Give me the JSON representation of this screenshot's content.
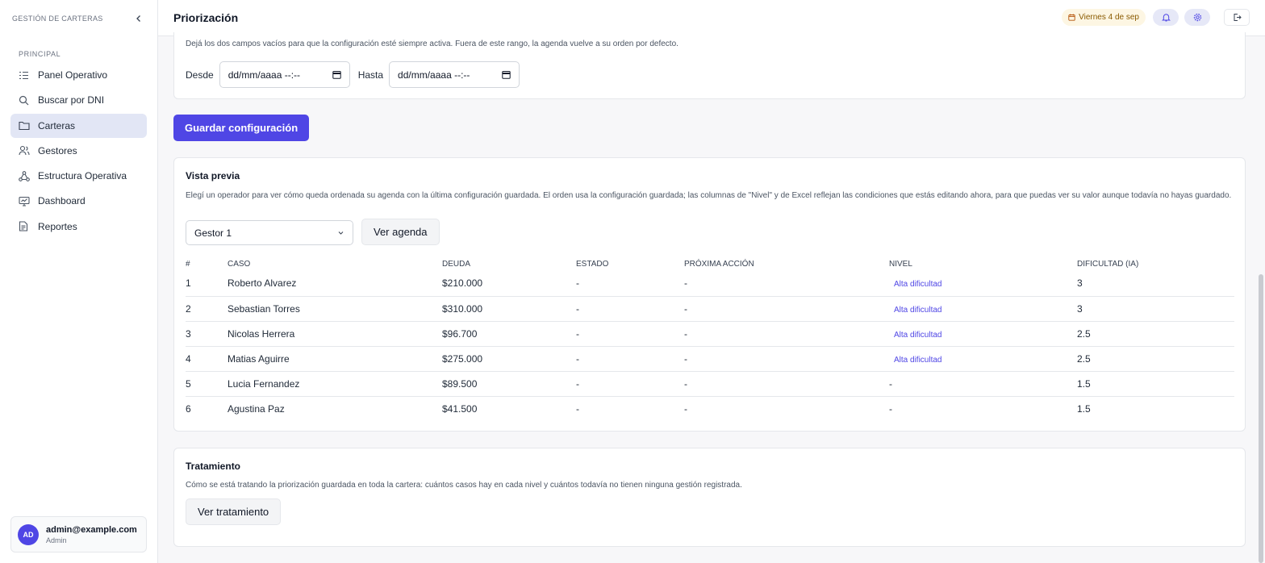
{
  "sidebar": {
    "brand": "GESTIÓN DE CARTERAS",
    "section": "PRINCIPAL",
    "items": [
      {
        "label": "Panel Operativo",
        "icon": "list-icon"
      },
      {
        "label": "Buscar por DNI",
        "icon": "search-icon"
      },
      {
        "label": "Carteras",
        "icon": "folder-icon",
        "active": true
      },
      {
        "label": "Gestores",
        "icon": "users-icon"
      },
      {
        "label": "Estructura Operativa",
        "icon": "hierarchy-icon"
      },
      {
        "label": "Dashboard",
        "icon": "monitor-icon"
      },
      {
        "label": "Reportes",
        "icon": "report-icon"
      }
    ],
    "user": {
      "initials": "AD",
      "email": "admin@example.com",
      "role": "Admin"
    }
  },
  "topbar": {
    "title": "Priorización",
    "date_badge": "Viernes 4 de sep",
    "accent": "#4f46e5"
  },
  "schedule": {
    "hint": "Dejá los dos campos vacíos para que la configuración esté siempre activa. Fuera de este rango, la agenda vuelve a su orden por defecto.",
    "from_label": "Desde",
    "to_label": "Hasta",
    "from_value": "dd/mm/aaaa --:--",
    "to_value": "dd/mm/aaaa --:--"
  },
  "save_label": "Guardar configuración",
  "preview": {
    "title": "Vista previa",
    "hint": "Elegí un operador para ver cómo queda ordenada su agenda con la última configuración guardada. El orden usa la configuración guardada; las columnas de \"Nivel\" y de Excel reflejan las condiciones que estás editando ahora, para que puedas ver su valor aunque todavía no hayas guardado.",
    "selected_operator": "Gestor 1",
    "button": "Ver agenda",
    "columns": [
      "#",
      "CASO",
      "DEUDA",
      "ESTADO",
      "PRÓXIMA ACCIÓN",
      "NIVEL",
      "DIFICULTAD (IA)"
    ],
    "rows": [
      {
        "n": "1",
        "caso": "Roberto Alvarez",
        "deuda": "$210.000",
        "estado": "-",
        "accion": "-",
        "nivel": "Alta dificultad",
        "dificultad": "3"
      },
      {
        "n": "2",
        "caso": "Sebastian Torres",
        "deuda": "$310.000",
        "estado": "-",
        "accion": "-",
        "nivel": "Alta dificultad",
        "dificultad": "3"
      },
      {
        "n": "3",
        "caso": "Nicolas Herrera",
        "deuda": "$96.700",
        "estado": "-",
        "accion": "-",
        "nivel": "Alta dificultad",
        "dificultad": "2.5"
      },
      {
        "n": "4",
        "caso": "Matias Aguirre",
        "deuda": "$275.000",
        "estado": "-",
        "accion": "-",
        "nivel": "Alta dificultad",
        "dificultad": "2.5"
      },
      {
        "n": "5",
        "caso": "Lucia Fernandez",
        "deuda": "$89.500",
        "estado": "-",
        "accion": "-",
        "nivel": "-",
        "dificultad": "1.5"
      },
      {
        "n": "6",
        "caso": "Agustina Paz",
        "deuda": "$41.500",
        "estado": "-",
        "accion": "-",
        "nivel": "-",
        "dificultad": "1.5"
      }
    ]
  },
  "treatment": {
    "title": "Tratamiento",
    "hint": "Cómo se está tratando la priorización guardada en toda la cartera: cuántos casos hay en cada nivel y cuántos todavía no tienen ninguna gestión registrada.",
    "button": "Ver tratamiento"
  }
}
